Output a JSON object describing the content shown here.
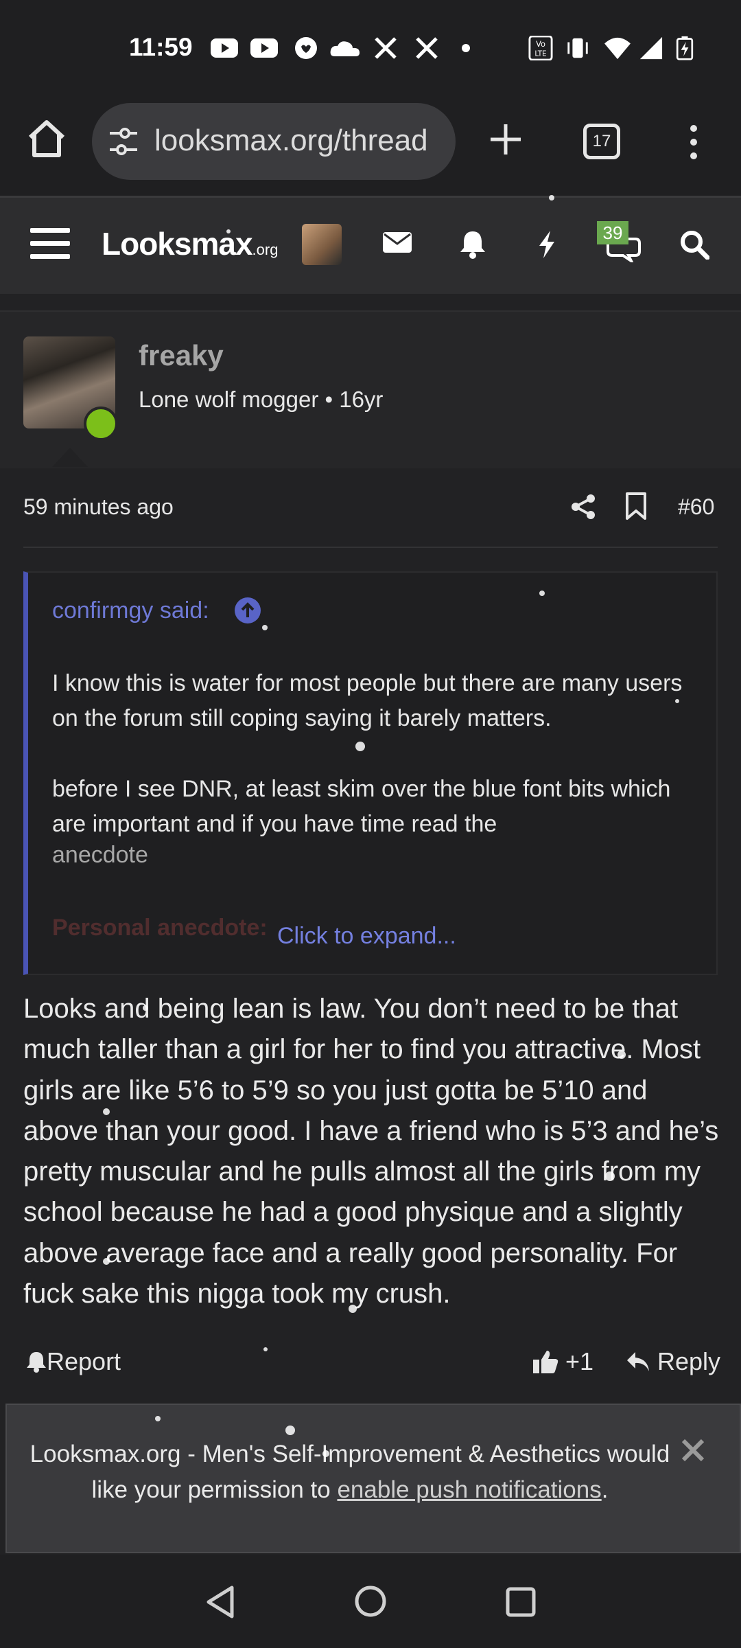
{
  "status_bar": {
    "time": "11:59",
    "battery_icon": "battery-charging-icon"
  },
  "browser": {
    "url": "looksmax.org/thread",
    "tab_count": "17"
  },
  "site_header": {
    "logo": "Looksmax",
    "logo_suffix": ".org",
    "conversation_badge": "39"
  },
  "post": {
    "username": "freaky",
    "user_title": "Lone wolf mogger • 16yr",
    "time": "59 minutes ago",
    "number": "#60",
    "quote": {
      "author": "confirmgy said:",
      "paragraph1": "I know this is water for most people but there are many users on the forum still coping saying it barely matters.",
      "paragraph2": "before I see DNR, at least skim over the blue font bits which are important and if you have time read the",
      "paragraph2_end": "anecdote",
      "faded": "Personal anecdote:",
      "expand": "Click to expand..."
    },
    "body": "Looks and being lean is law. You don’t need to be that much taller than a girl for her to find you attractive. Most girls are like 5’6 to 5’9 so you just gotta be 5’10 and above than your good. I have a friend who is 5’3 and he’s pretty muscular and he pulls almost all the girls from my school because he had a good physique and a slightly above average face and a really good personality. For fuck sake this nigga took my crush.",
    "actions": {
      "report": "Report",
      "like": "+1",
      "reply": "Reply"
    }
  },
  "notification": {
    "text_before": "Looksmax.org - Men's Self-Improvement & Aesthetics would like your permission to",
    "link": "enable push notifications",
    "text_after": "."
  }
}
